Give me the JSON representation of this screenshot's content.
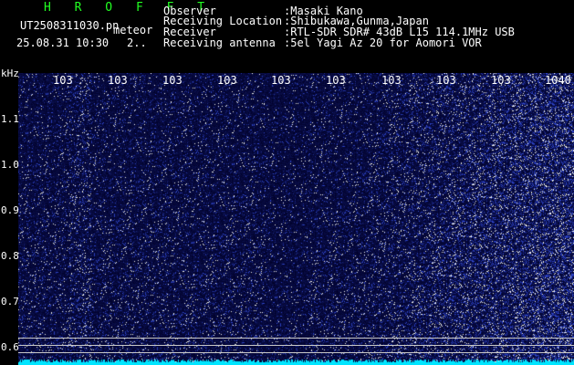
{
  "header": {
    "brand": "H R O F F T",
    "filename": "UT2508311030.pn",
    "mode": "meteor",
    "datetime": "25.08.31 10:30",
    "frame": "2.."
  },
  "info": {
    "labels": [
      "Observer",
      "Receiving Location",
      "Receiver",
      "Receiving antenna"
    ],
    "values": [
      ":Masaki Kano",
      ":Shibukawa,Gunma,Japan",
      ":RTL-SDR SDR# 43dB L15 114.1MHz USB",
      ":5el Yagi Az 20 for Aomori VOR"
    ]
  },
  "axis": {
    "unit": "kHz",
    "x_ticks": [
      "103",
      "103",
      "103",
      "103",
      "103",
      "103",
      "103",
      "103",
      "103",
      "1040"
    ],
    "y_ticks": [
      "1.1",
      "1.0",
      "0.9",
      "0.8",
      "0.7",
      "0.6"
    ]
  },
  "colors": {
    "background": "#000000",
    "text": "#ffffff",
    "brand": "#22ff22",
    "noise": "#2a3cff",
    "baseline": "#00e5ff"
  }
}
